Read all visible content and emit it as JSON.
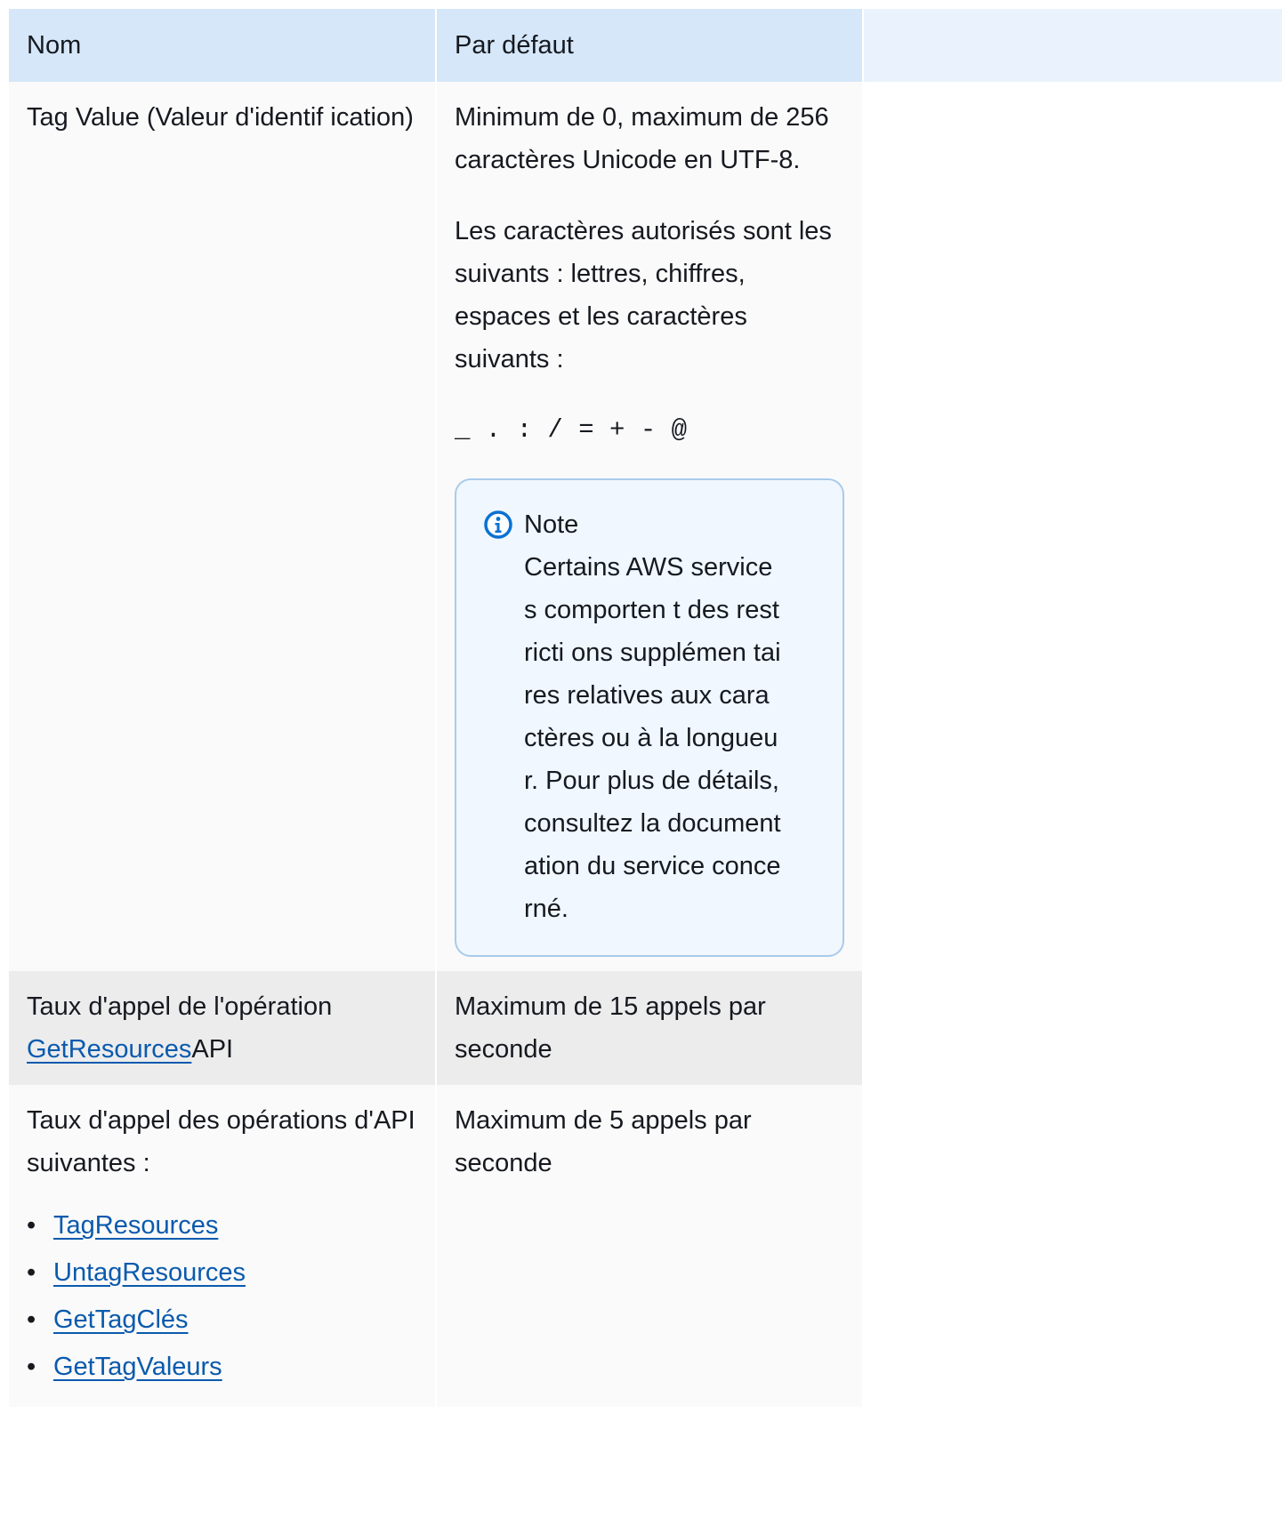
{
  "table": {
    "headers": {
      "name": "Nom",
      "default": "Par défaut"
    },
    "rows": [
      {
        "name": "Tag Value (Valeur d'identif ication)",
        "default_paragraphs": [
          "Minimum de 0, maximum de 256 caractères Unicode en UTF-8.",
          "Les caractères autorisés sont les suivants : lettres, chiffres, espaces et les caractères suivants :"
        ],
        "allowed_chars": "_ . : / = + - @",
        "note": {
          "icon": "info-icon",
          "title": "Note",
          "body": "Certains AWS services comporten t des restricti ons supplémen taires relatives aux caractères ou à la longueur. Pour plus de détails, consultez la documentation du service concerné."
        }
      },
      {
        "name_prefix": "Taux d'appel de l'opération ",
        "name_link": "GetResources",
        "name_suffix": "API",
        "default": "Maximum de 15 appels par seconde"
      },
      {
        "name": "Taux d'appel des opérations d'API suivantes :",
        "api_links": [
          "TagResources",
          "UntagResources",
          "GetTagClés",
          "GetTagValeurs"
        ],
        "default": "Maximum de 5 appels par seconde"
      }
    ]
  },
  "colors": {
    "header_bg": "#d5e7f9",
    "row_light": "#fafafa",
    "row_grey": "#ececed",
    "link": "#0a5aad",
    "note_border": "#a8cbec",
    "note_bg": "#f0f7fe",
    "info_icon": "#0972d3"
  }
}
